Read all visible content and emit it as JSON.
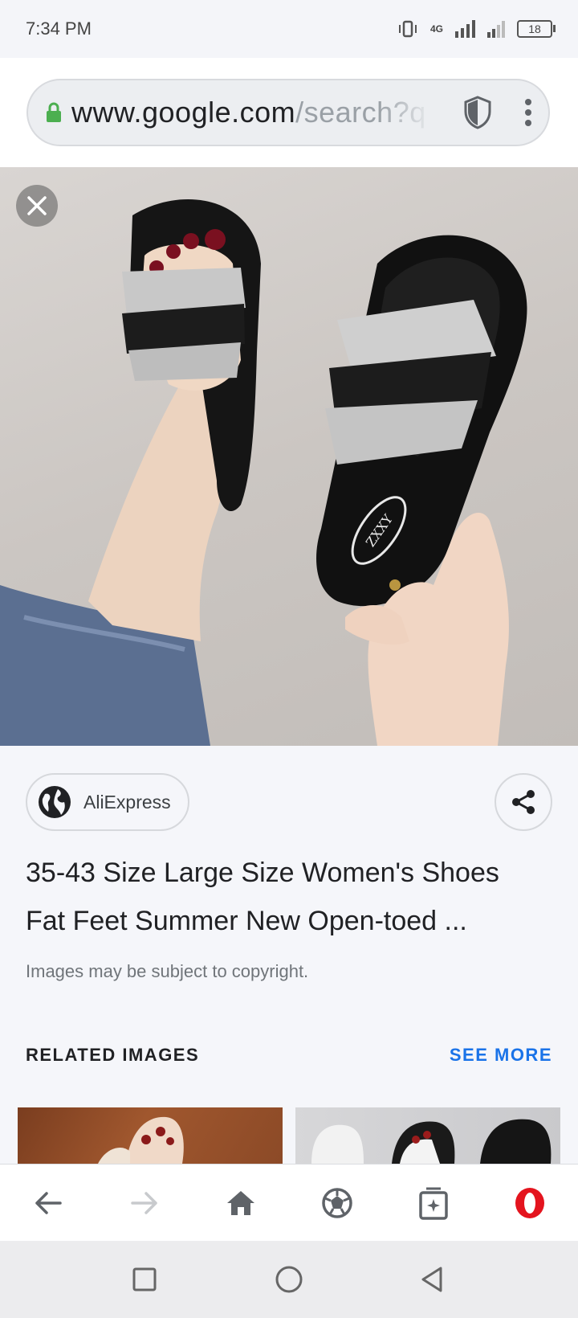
{
  "status_bar": {
    "time": "7:34 PM",
    "network": "4G",
    "battery": "18"
  },
  "url_bar": {
    "host": "www.google.com",
    "path": "/search?q"
  },
  "photo": {
    "brand_mark": "ZXXY"
  },
  "result": {
    "source": "AliExpress",
    "title_line1": "35-43 Size Large Size Women's Shoes",
    "title_line2": "Fat Feet Summer New Open-toed ...",
    "copyright": "Images may be subject to copyright."
  },
  "related": {
    "header": "RELATED IMAGES",
    "see_more": "SEE MORE"
  },
  "toolbar": {
    "items": [
      "back-icon",
      "forward-icon",
      "home-icon",
      "speed-dial-icon",
      "tabs-icon",
      "opera-menu-icon"
    ]
  },
  "colors": {
    "accent": "#1a73e8",
    "opera_red": "#e4141e",
    "lock_green": "#4caf50"
  }
}
